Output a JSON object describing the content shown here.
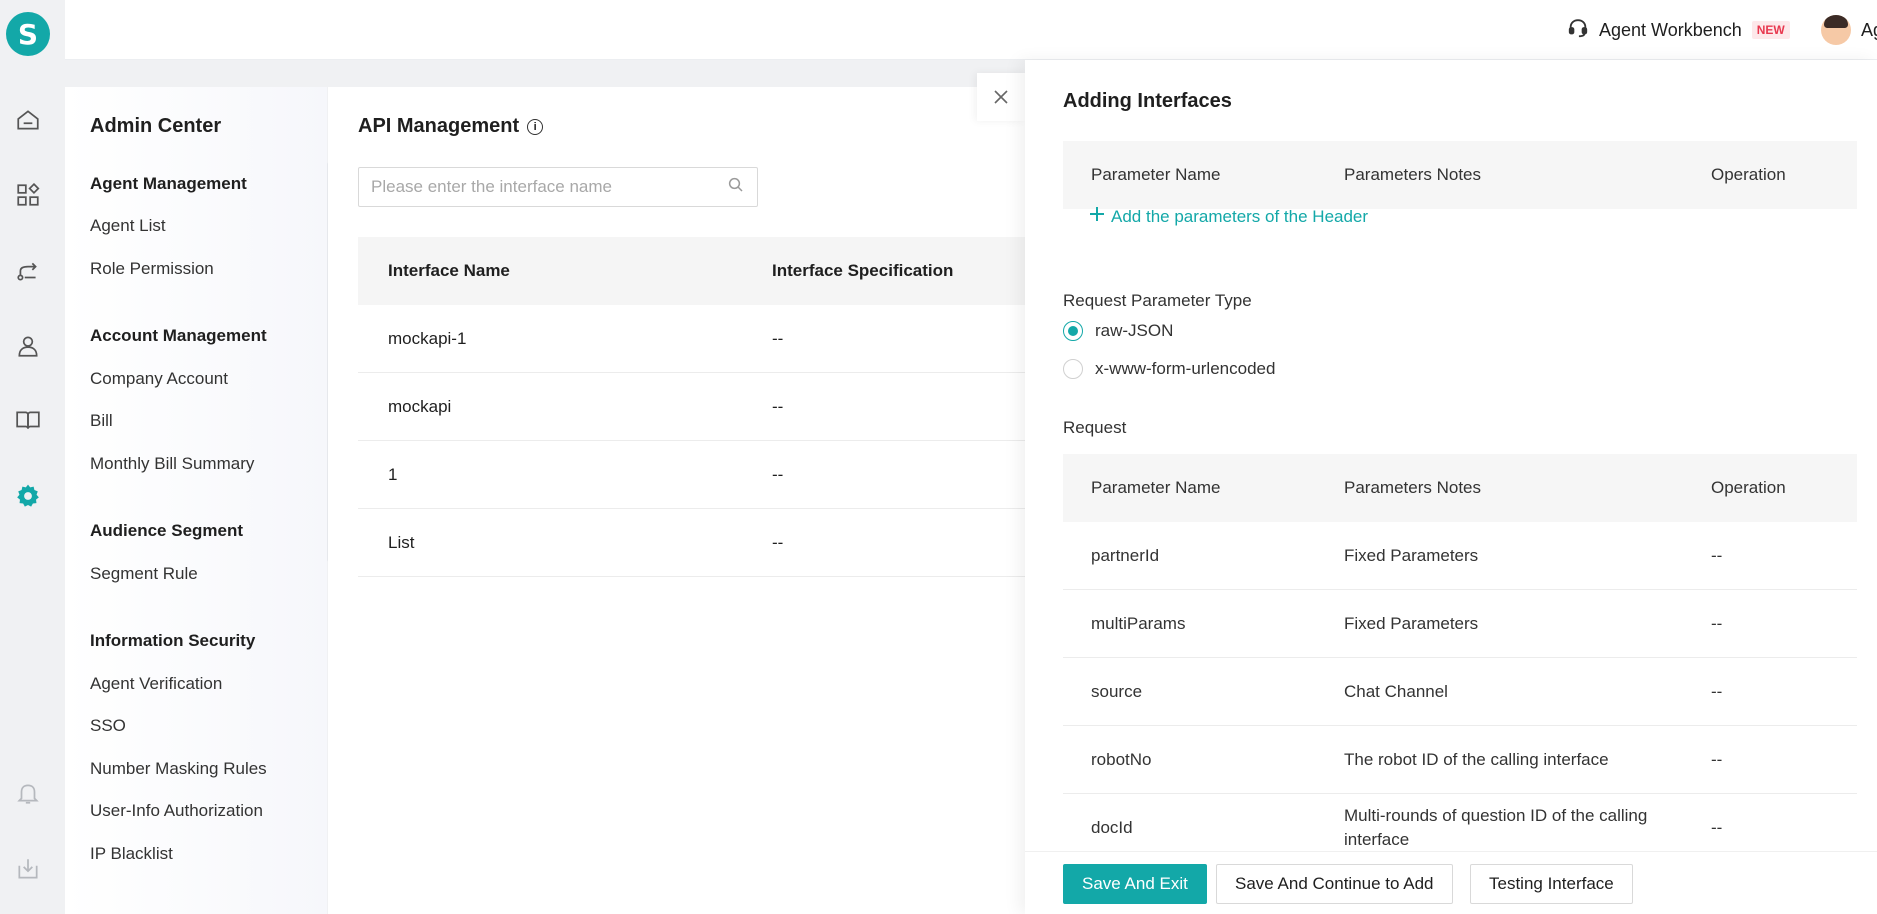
{
  "logo": {
    "letter": "S"
  },
  "header": {
    "workbench_label": "Agent Workbench",
    "new_badge": "NEW",
    "user_name": "Agent"
  },
  "admin": {
    "title": "Admin Center",
    "groups": [
      {
        "heading": "Agent Management",
        "items": [
          "Agent List",
          "Role Permission"
        ]
      },
      {
        "heading": "Account Management",
        "items": [
          "Company Account",
          "Bill",
          "Monthly Bill Summary"
        ]
      },
      {
        "heading": "Audience Segment",
        "items": [
          "Segment Rule"
        ]
      },
      {
        "heading": "Information Security",
        "items": [
          "Agent Verification",
          "SSO",
          "Number Masking Rules",
          "User-Info Authorization",
          "IP Blacklist"
        ]
      }
    ]
  },
  "main": {
    "title": "API Management",
    "search_placeholder": "Please enter the interface name",
    "columns": [
      "Interface Name",
      "Interface Specification"
    ],
    "rows": [
      [
        "mockapi-1",
        "--"
      ],
      [
        "mockapi",
        "--"
      ],
      [
        "1",
        "--"
      ],
      [
        "List",
        "--"
      ]
    ]
  },
  "drawer": {
    "title": "Adding Interfaces",
    "header_table": {
      "columns": [
        "Parameter Name",
        "Parameters Notes",
        "Operation"
      ]
    },
    "add_header_link": "Add the parameters of the Header",
    "request_type_label": "Request Parameter Type",
    "request_types": [
      {
        "label": "raw-JSON",
        "selected": true
      },
      {
        "label": "x-www-form-urlencoded",
        "selected": false
      }
    ],
    "request_label": "Request",
    "request_table": {
      "columns": [
        "Parameter Name",
        "Parameters Notes",
        "Operation"
      ],
      "rows": [
        [
          "partnerId",
          "Fixed Parameters",
          "--"
        ],
        [
          "multiParams",
          "Fixed Parameters",
          "--"
        ],
        [
          "source",
          "Chat Channel",
          "--"
        ],
        [
          "robotNo",
          "The robot ID of the calling interface",
          "--"
        ],
        [
          "docId",
          "Multi-rounds of question ID of the calling interface",
          "--"
        ]
      ]
    },
    "buttons": {
      "save_exit": "Save And Exit",
      "save_continue": "Save And Continue to Add",
      "testing": "Testing Interface"
    }
  },
  "colors": {
    "accent": "#13a8a8",
    "badge": "#e8384f"
  }
}
